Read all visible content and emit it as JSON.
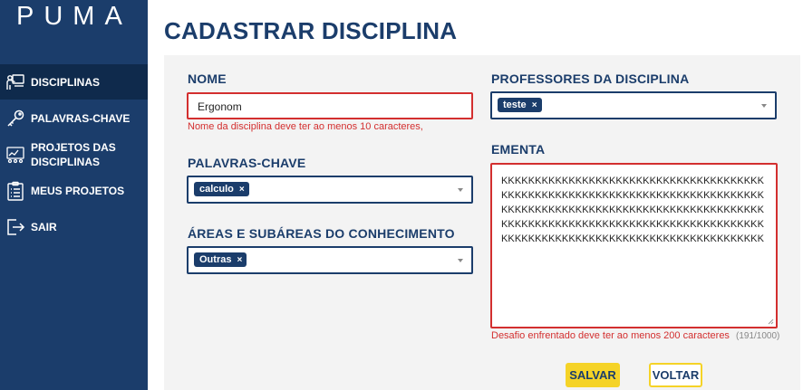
{
  "sidebar": {
    "brand": "PUMA",
    "items": [
      {
        "label": "DISCIPLINAS",
        "icon": "teacher-board-icon"
      },
      {
        "label": "PALAVRAS-CHAVE",
        "icon": "key-icon"
      },
      {
        "label_line1": "PROJETOS DAS",
        "label_line2": "DISCIPLINAS",
        "icon": "projects-board-icon"
      },
      {
        "label": "MEUS PROJETOS",
        "icon": "clipboard-list-icon"
      },
      {
        "label": "SAIR",
        "icon": "logout-icon"
      }
    ]
  },
  "main": {
    "title": "CADASTRAR DISCIPLINA",
    "form": {
      "nome": {
        "label": "NOME",
        "value": "Ergonom",
        "error": "Nome da disciplina deve ter ao menos 10 caracteres,"
      },
      "palavras_chave": {
        "label": "PALAVRAS-CHAVE",
        "chips": [
          "calculo"
        ]
      },
      "areas": {
        "label": "ÁREAS E SUBÁREAS DO CONHECIMENTO",
        "chips": [
          "Outras"
        ]
      },
      "professores": {
        "label": "PROFESSORES DA DISCIPLINA",
        "chips": [
          "teste"
        ]
      },
      "ementa": {
        "label": "EMENTA",
        "value": "KKKKKKKKKKKKKKKKKKKKKKKKKKKKKKKKKKKKKKKKKKKKKKKKKKKKKKKKKKKKKKKKKKKKKKKKKKKKKKKKKKKKKKKKKKKKKKKKKKKKKKKKKKKKKKKKKKKKKKKKKKKKKKKKKKKKKKKKKKKKKKKKKKKKKKKKKKKKKKKKKKKKKKKKKKKKKKKKKKKKKKKKKKKKKKKKKKK",
        "error": "Desafio enfrentado deve ter ao menos 200 caracteres",
        "counter": "(191/1000)"
      },
      "chip_remove": "×"
    },
    "buttons": {
      "save": "SALVAR",
      "back": "VOLTAR"
    }
  },
  "colors": {
    "sidebar_bg": "#1b3d6b",
    "sidebar_active": "#0f2a4c",
    "primary": "#1b3d6b",
    "error": "#d32f2f",
    "accent": "#f5d327",
    "panel_bg": "#f3f3f3"
  }
}
